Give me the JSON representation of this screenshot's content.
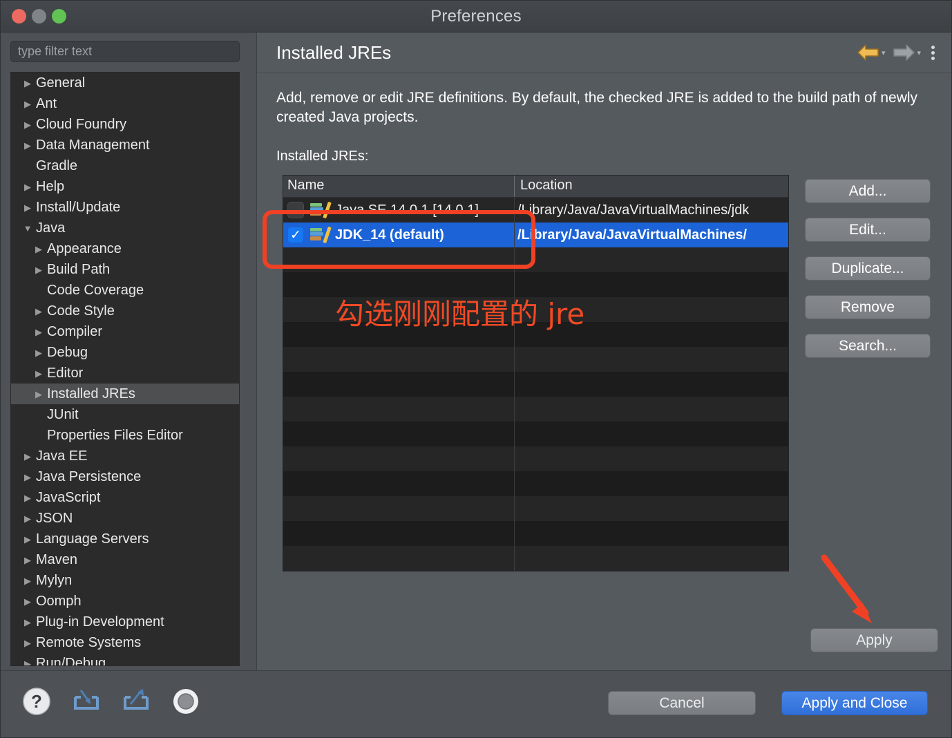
{
  "window": {
    "title": "Preferences",
    "controls": [
      "close-button",
      "minimize-button",
      "maximize-button"
    ]
  },
  "sidebar": {
    "filter": {
      "placeholder": "type filter text",
      "value": ""
    },
    "items": [
      {
        "label": "General",
        "level": 0,
        "expandable": true,
        "expanded": false,
        "selected": false
      },
      {
        "label": "Ant",
        "level": 0,
        "expandable": true,
        "expanded": false,
        "selected": false
      },
      {
        "label": "Cloud Foundry",
        "level": 0,
        "expandable": true,
        "expanded": false,
        "selected": false
      },
      {
        "label": "Data Management",
        "level": 0,
        "expandable": true,
        "expanded": false,
        "selected": false
      },
      {
        "label": "Gradle",
        "level": 0,
        "expandable": false,
        "expanded": false,
        "selected": false
      },
      {
        "label": "Help",
        "level": 0,
        "expandable": true,
        "expanded": false,
        "selected": false
      },
      {
        "label": "Install/Update",
        "level": 0,
        "expandable": true,
        "expanded": false,
        "selected": false
      },
      {
        "label": "Java",
        "level": 0,
        "expandable": true,
        "expanded": true,
        "selected": false
      },
      {
        "label": "Appearance",
        "level": 1,
        "expandable": true,
        "expanded": false,
        "selected": false
      },
      {
        "label": "Build Path",
        "level": 1,
        "expandable": true,
        "expanded": false,
        "selected": false
      },
      {
        "label": "Code Coverage",
        "level": 1,
        "expandable": false,
        "expanded": false,
        "selected": false
      },
      {
        "label": "Code Style",
        "level": 1,
        "expandable": true,
        "expanded": false,
        "selected": false
      },
      {
        "label": "Compiler",
        "level": 1,
        "expandable": true,
        "expanded": false,
        "selected": false
      },
      {
        "label": "Debug",
        "level": 1,
        "expandable": true,
        "expanded": false,
        "selected": false
      },
      {
        "label": "Editor",
        "level": 1,
        "expandable": true,
        "expanded": false,
        "selected": false
      },
      {
        "label": "Installed JREs",
        "level": 1,
        "expandable": true,
        "expanded": false,
        "selected": true
      },
      {
        "label": "JUnit",
        "level": 1,
        "expandable": false,
        "expanded": false,
        "selected": false
      },
      {
        "label": "Properties Files Editor",
        "level": 1,
        "expandable": false,
        "expanded": false,
        "selected": false
      },
      {
        "label": "Java EE",
        "level": 0,
        "expandable": true,
        "expanded": false,
        "selected": false
      },
      {
        "label": "Java Persistence",
        "level": 0,
        "expandable": true,
        "expanded": false,
        "selected": false
      },
      {
        "label": "JavaScript",
        "level": 0,
        "expandable": true,
        "expanded": false,
        "selected": false
      },
      {
        "label": "JSON",
        "level": 0,
        "expandable": true,
        "expanded": false,
        "selected": false
      },
      {
        "label": "Language Servers",
        "level": 0,
        "expandable": true,
        "expanded": false,
        "selected": false
      },
      {
        "label": "Maven",
        "level": 0,
        "expandable": true,
        "expanded": false,
        "selected": false
      },
      {
        "label": "Mylyn",
        "level": 0,
        "expandable": true,
        "expanded": false,
        "selected": false
      },
      {
        "label": "Oomph",
        "level": 0,
        "expandable": true,
        "expanded": false,
        "selected": false
      },
      {
        "label": "Plug-in Development",
        "level": 0,
        "expandable": true,
        "expanded": false,
        "selected": false
      },
      {
        "label": "Remote Systems",
        "level": 0,
        "expandable": true,
        "expanded": false,
        "selected": false
      },
      {
        "label": "Run/Debug",
        "level": 0,
        "expandable": true,
        "expanded": false,
        "selected": false
      }
    ]
  },
  "main": {
    "title": "Installed JREs",
    "description": "Add, remove or edit JRE definitions. By default, the checked JRE is added to the build path of newly created Java projects.",
    "list_label": "Installed JREs:",
    "nav": {
      "back": "back-arrow-icon",
      "back_color": "#e8a33d",
      "forward": "forward-arrow-icon",
      "forward_color": "#9aa0a4",
      "menu": "kebab-menu-icon"
    },
    "table": {
      "columns": [
        "Name",
        "Location"
      ],
      "rows": [
        {
          "checked": false,
          "name": "Java SE 14.0.1 [14.0.1]",
          "location": "/Library/Java/JavaVirtualMachines/jdk",
          "selected": false
        },
        {
          "checked": true,
          "name": "JDK_14 (default)",
          "location": "/Library/Java/JavaVirtualMachines/",
          "selected": true
        }
      ],
      "empty_rows": 14
    },
    "buttons": [
      {
        "label": "Add..."
      },
      {
        "label": "Edit..."
      },
      {
        "label": "Duplicate..."
      },
      {
        "label": "Remove"
      },
      {
        "label": "Search..."
      }
    ],
    "apply_label": "Apply"
  },
  "bottom": {
    "icons": [
      "help-icon",
      "import-icon",
      "export-icon",
      "restore-defaults-icon"
    ],
    "cancel_label": "Cancel",
    "apply_and_close_label": "Apply and Close"
  },
  "annotations": {
    "highlight_color": "#f04124",
    "note_text": "勾选刚刚配置的 jre",
    "arrow": "down-right-arrow-annotation"
  },
  "colors": {
    "selection_blue": "#1b63d7",
    "primary_blue": "#2f6fd8",
    "annotation_red": "#f04124",
    "window_bg": "#4e5257",
    "tree_bg": "#2b2b2b"
  }
}
